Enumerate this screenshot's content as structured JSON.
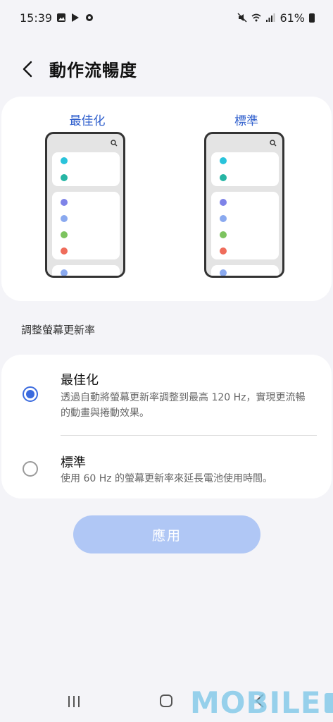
{
  "status_bar": {
    "time": "15:39",
    "battery": "61%",
    "icons_left": [
      "gallery-icon",
      "play-store-icon",
      "settings-gear-icon"
    ],
    "icons_right": [
      "mute-icon",
      "wifi-icon",
      "signal-icon",
      "battery-icon"
    ]
  },
  "header": {
    "title": "動作流暢度"
  },
  "preview": {
    "left_label": "最佳化",
    "right_label": "標準",
    "dot_colors": [
      "#29c3db",
      "#26b5a4",
      "#7e83e8",
      "#8aa9ef",
      "#7cc35f",
      "#ef6c5b"
    ]
  },
  "section": {
    "label": "調整螢幕更新率"
  },
  "options": [
    {
      "title": "最佳化",
      "description": "透過自動將螢幕更新率調整到最高 120 Hz，實現更流暢的動畫與捲動效果。",
      "selected": true
    },
    {
      "title": "標準",
      "description": "使用 60 Hz 的螢幕更新率來延長電池使用時間。",
      "selected": false
    }
  ],
  "apply_button": {
    "label": "應用"
  },
  "watermark": {
    "text": "MOBILE"
  },
  "colors": {
    "accent": "#3b6bde",
    "button_disabled": "#b0c7f5",
    "label_blue": "#2f5fcd"
  }
}
